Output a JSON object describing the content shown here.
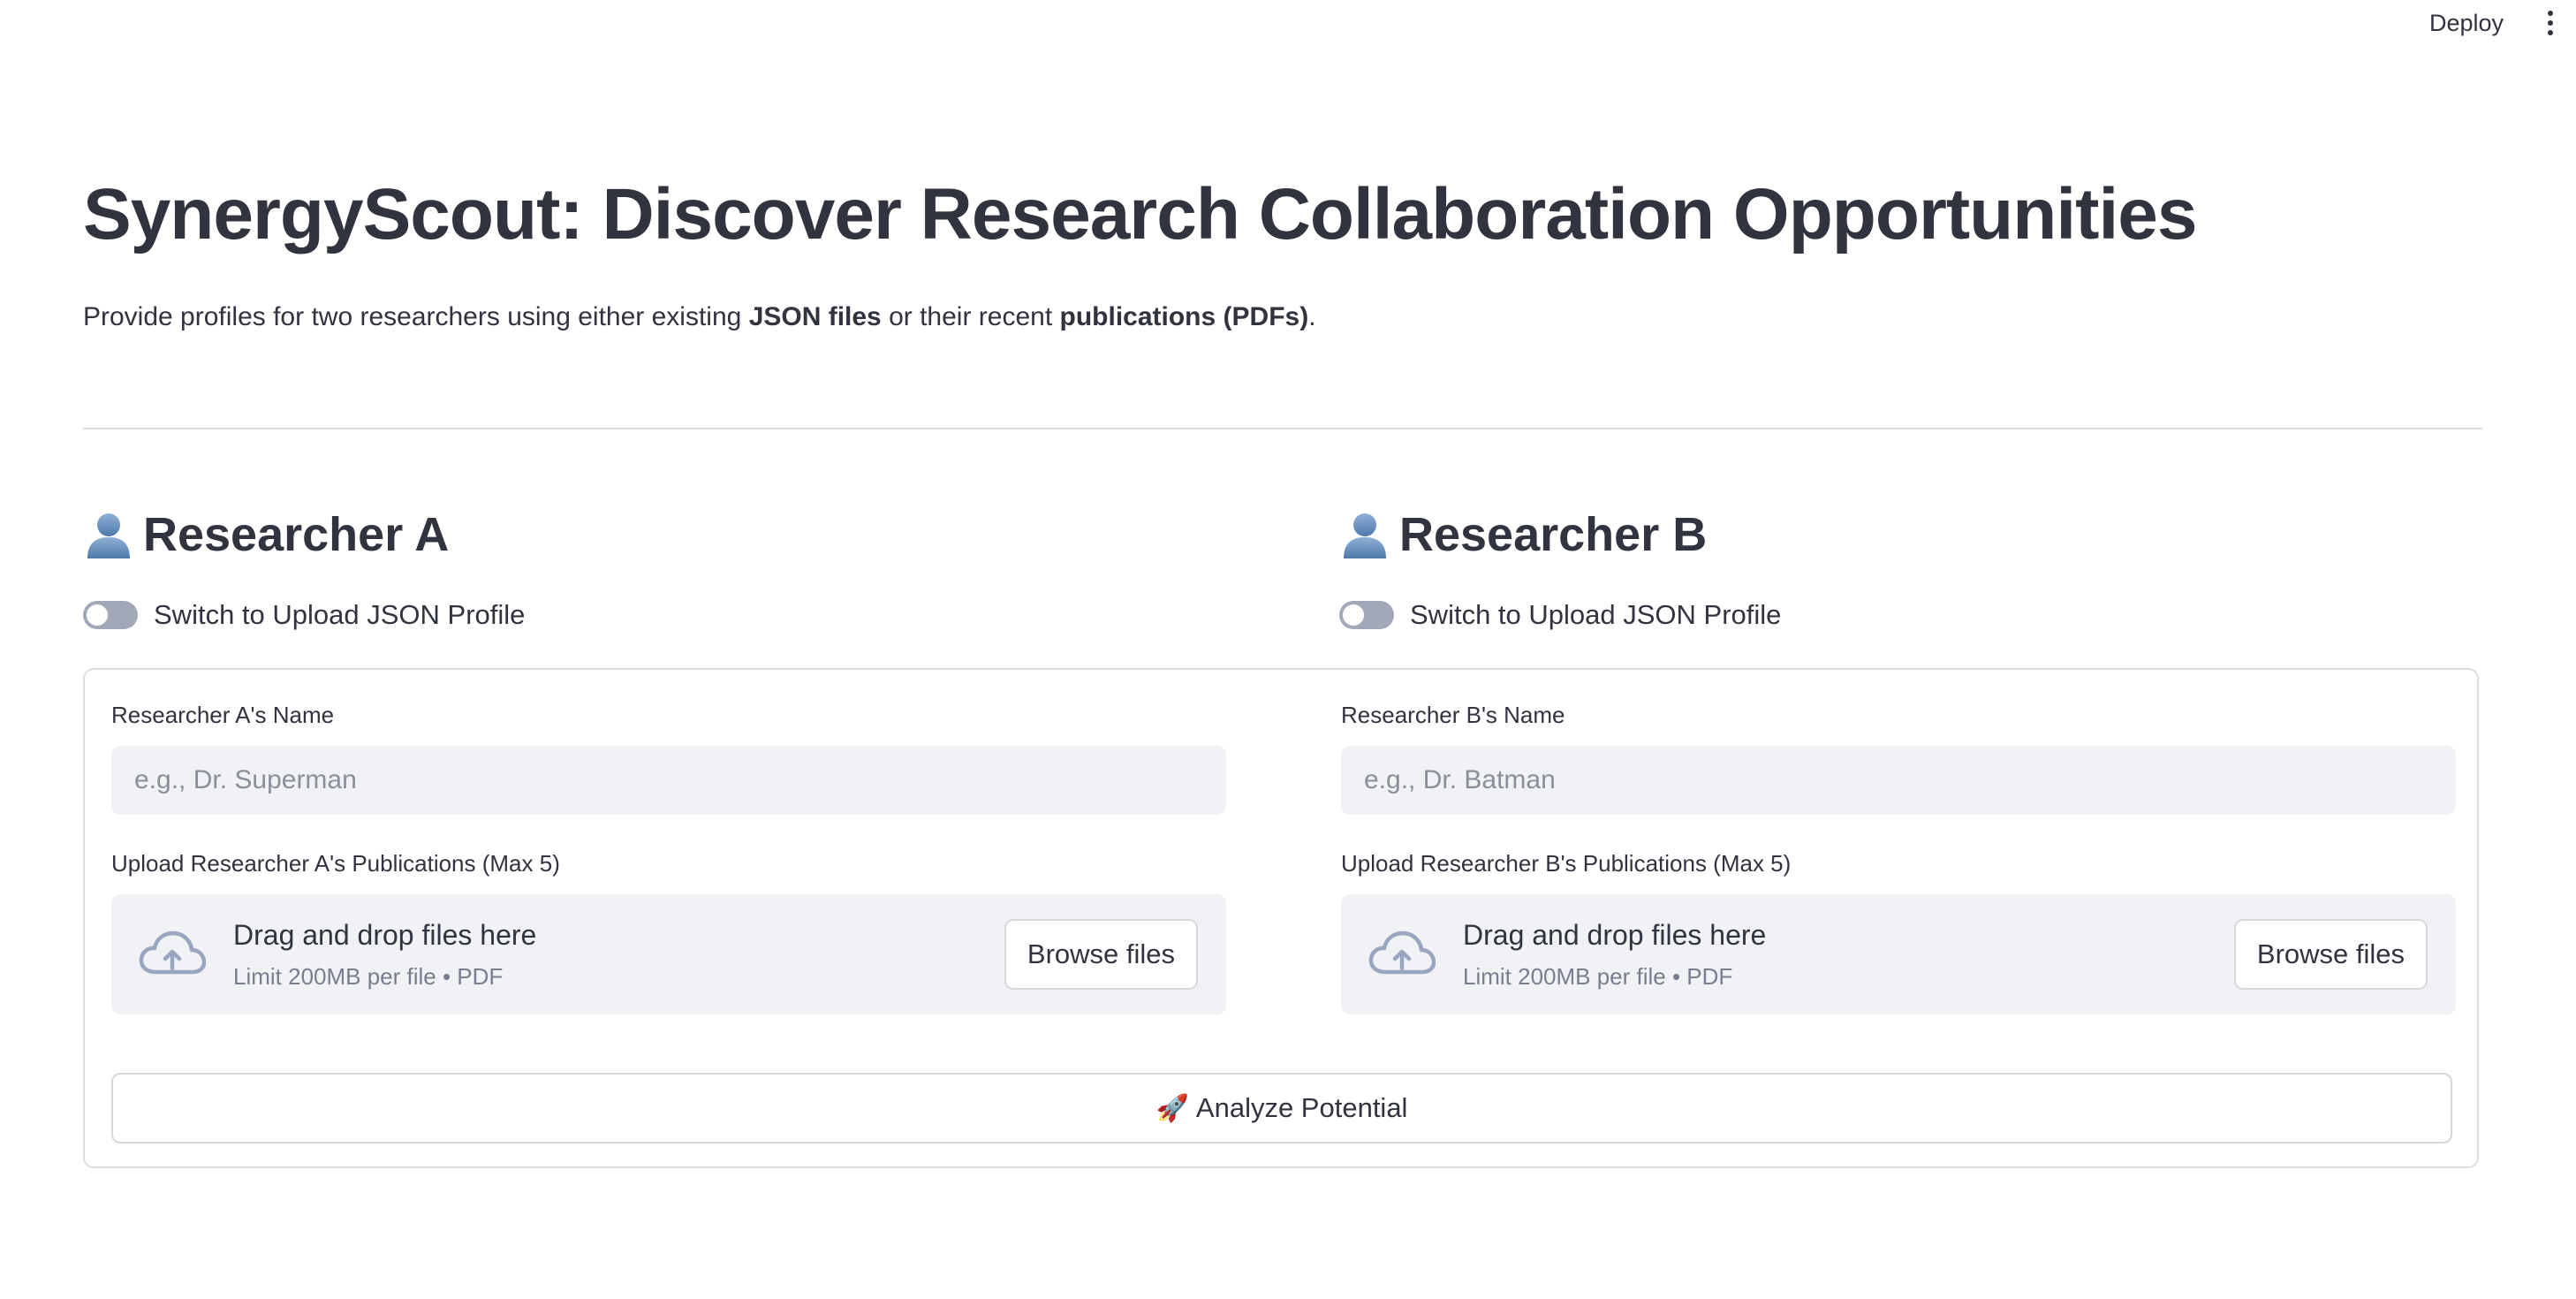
{
  "topbar": {
    "deploy_label": "Deploy"
  },
  "page": {
    "title": "SynergyScout: Discover Research Collaboration Opportunities",
    "subtitle": {
      "part1": "Provide profiles for two researchers using either existing ",
      "bold1": "JSON files",
      "part2": " or their recent ",
      "bold2": "publications (PDFs)",
      "part3": "."
    }
  },
  "researcher_a": {
    "heading": "Researcher A",
    "toggle_label": "Switch to Upload JSON Profile",
    "toggle_on": false,
    "name_label": "Researcher A's Name",
    "name_placeholder": "e.g., Dr. Superman",
    "name_value": "",
    "upload_label": "Upload Researcher A's Publications (Max 5)",
    "dropzone_title": "Drag and drop files here",
    "dropzone_limit": "Limit 200MB per file • PDF",
    "browse_label": "Browse files"
  },
  "researcher_b": {
    "heading": "Researcher B",
    "toggle_label": "Switch to Upload JSON Profile",
    "toggle_on": false,
    "name_label": "Researcher B's Name",
    "name_placeholder": "e.g., Dr. Batman",
    "name_value": "",
    "upload_label": "Upload Researcher B's Publications (Max 5)",
    "dropzone_title": "Drag and drop files here",
    "dropzone_limit": "Limit 200MB per file • PDF",
    "browse_label": "Browse files"
  },
  "actions": {
    "analyze_label": "Analyze Potential",
    "analyze_icon": "rocket-icon"
  },
  "icons": {
    "heading_icon": "person-icon",
    "upload_icon": "cloud-upload-icon"
  },
  "colors": {
    "text": "#31333f",
    "input_bg": "#f0f2f6",
    "toggle_off": "#a3a8b8",
    "border": "#dcdde2"
  }
}
